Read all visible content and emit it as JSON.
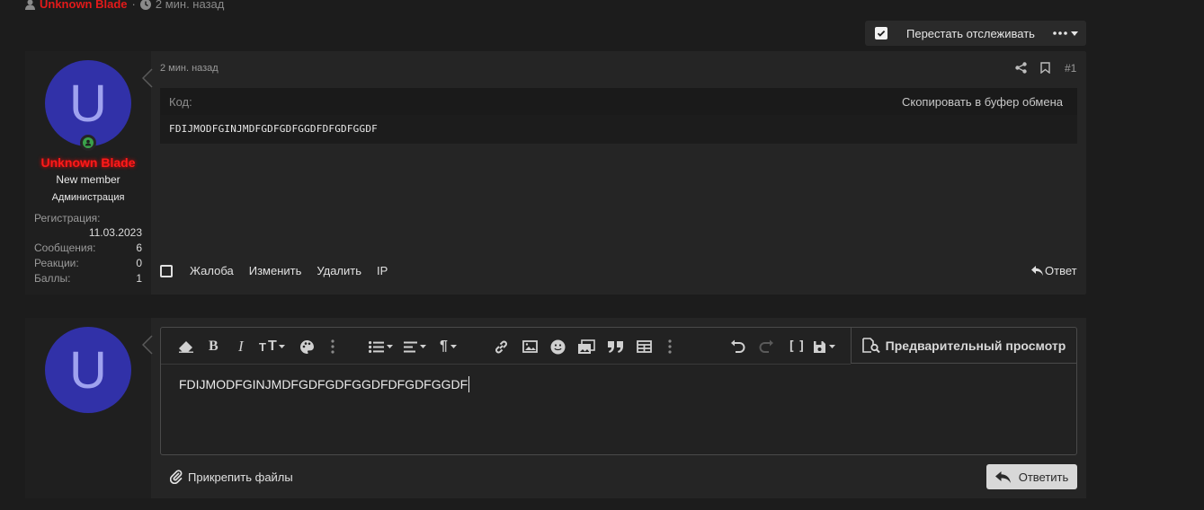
{
  "top_meta": {
    "username": "Unknown Blade",
    "separator": "·",
    "time": "2 мин. назад"
  },
  "watch": {
    "label": "Перестать отслеживать",
    "checked": true
  },
  "post": {
    "time": "2 мин. назад",
    "number": "#1",
    "code": {
      "label": "Код:",
      "copy_label": "Скопировать в буфер обмена",
      "content": "FDIJMODFGINJMDFGDFGDFGGDFDFGDFGGDF"
    },
    "actions": {
      "report": "Жалоба",
      "edit": "Изменить",
      "delete": "Удалить",
      "ip": "IP",
      "reply": "Ответ"
    }
  },
  "user": {
    "avatar_letter": "U",
    "name": "Unknown Blade",
    "title": "New member",
    "group": "Администрация",
    "stats": [
      {
        "label": "Регистрация:",
        "value": "11.03.2023"
      },
      {
        "label": "Сообщения:",
        "value": "6"
      },
      {
        "label": "Реакции:",
        "value": "0"
      },
      {
        "label": "Баллы:",
        "value": "1"
      }
    ]
  },
  "reply": {
    "avatar_letter": "U",
    "editor_text": "FDIJMODFGINJMDFGDFGDFGGDFDFGDFGGDF",
    "preview_label": "Предварительный просмотр",
    "attach_label": "Прикрепить файлы",
    "submit_label": "Ответить"
  },
  "colors": {
    "username": "#e21a1a",
    "avatar_bg": "#3131a8",
    "online": "#3aa14a"
  }
}
